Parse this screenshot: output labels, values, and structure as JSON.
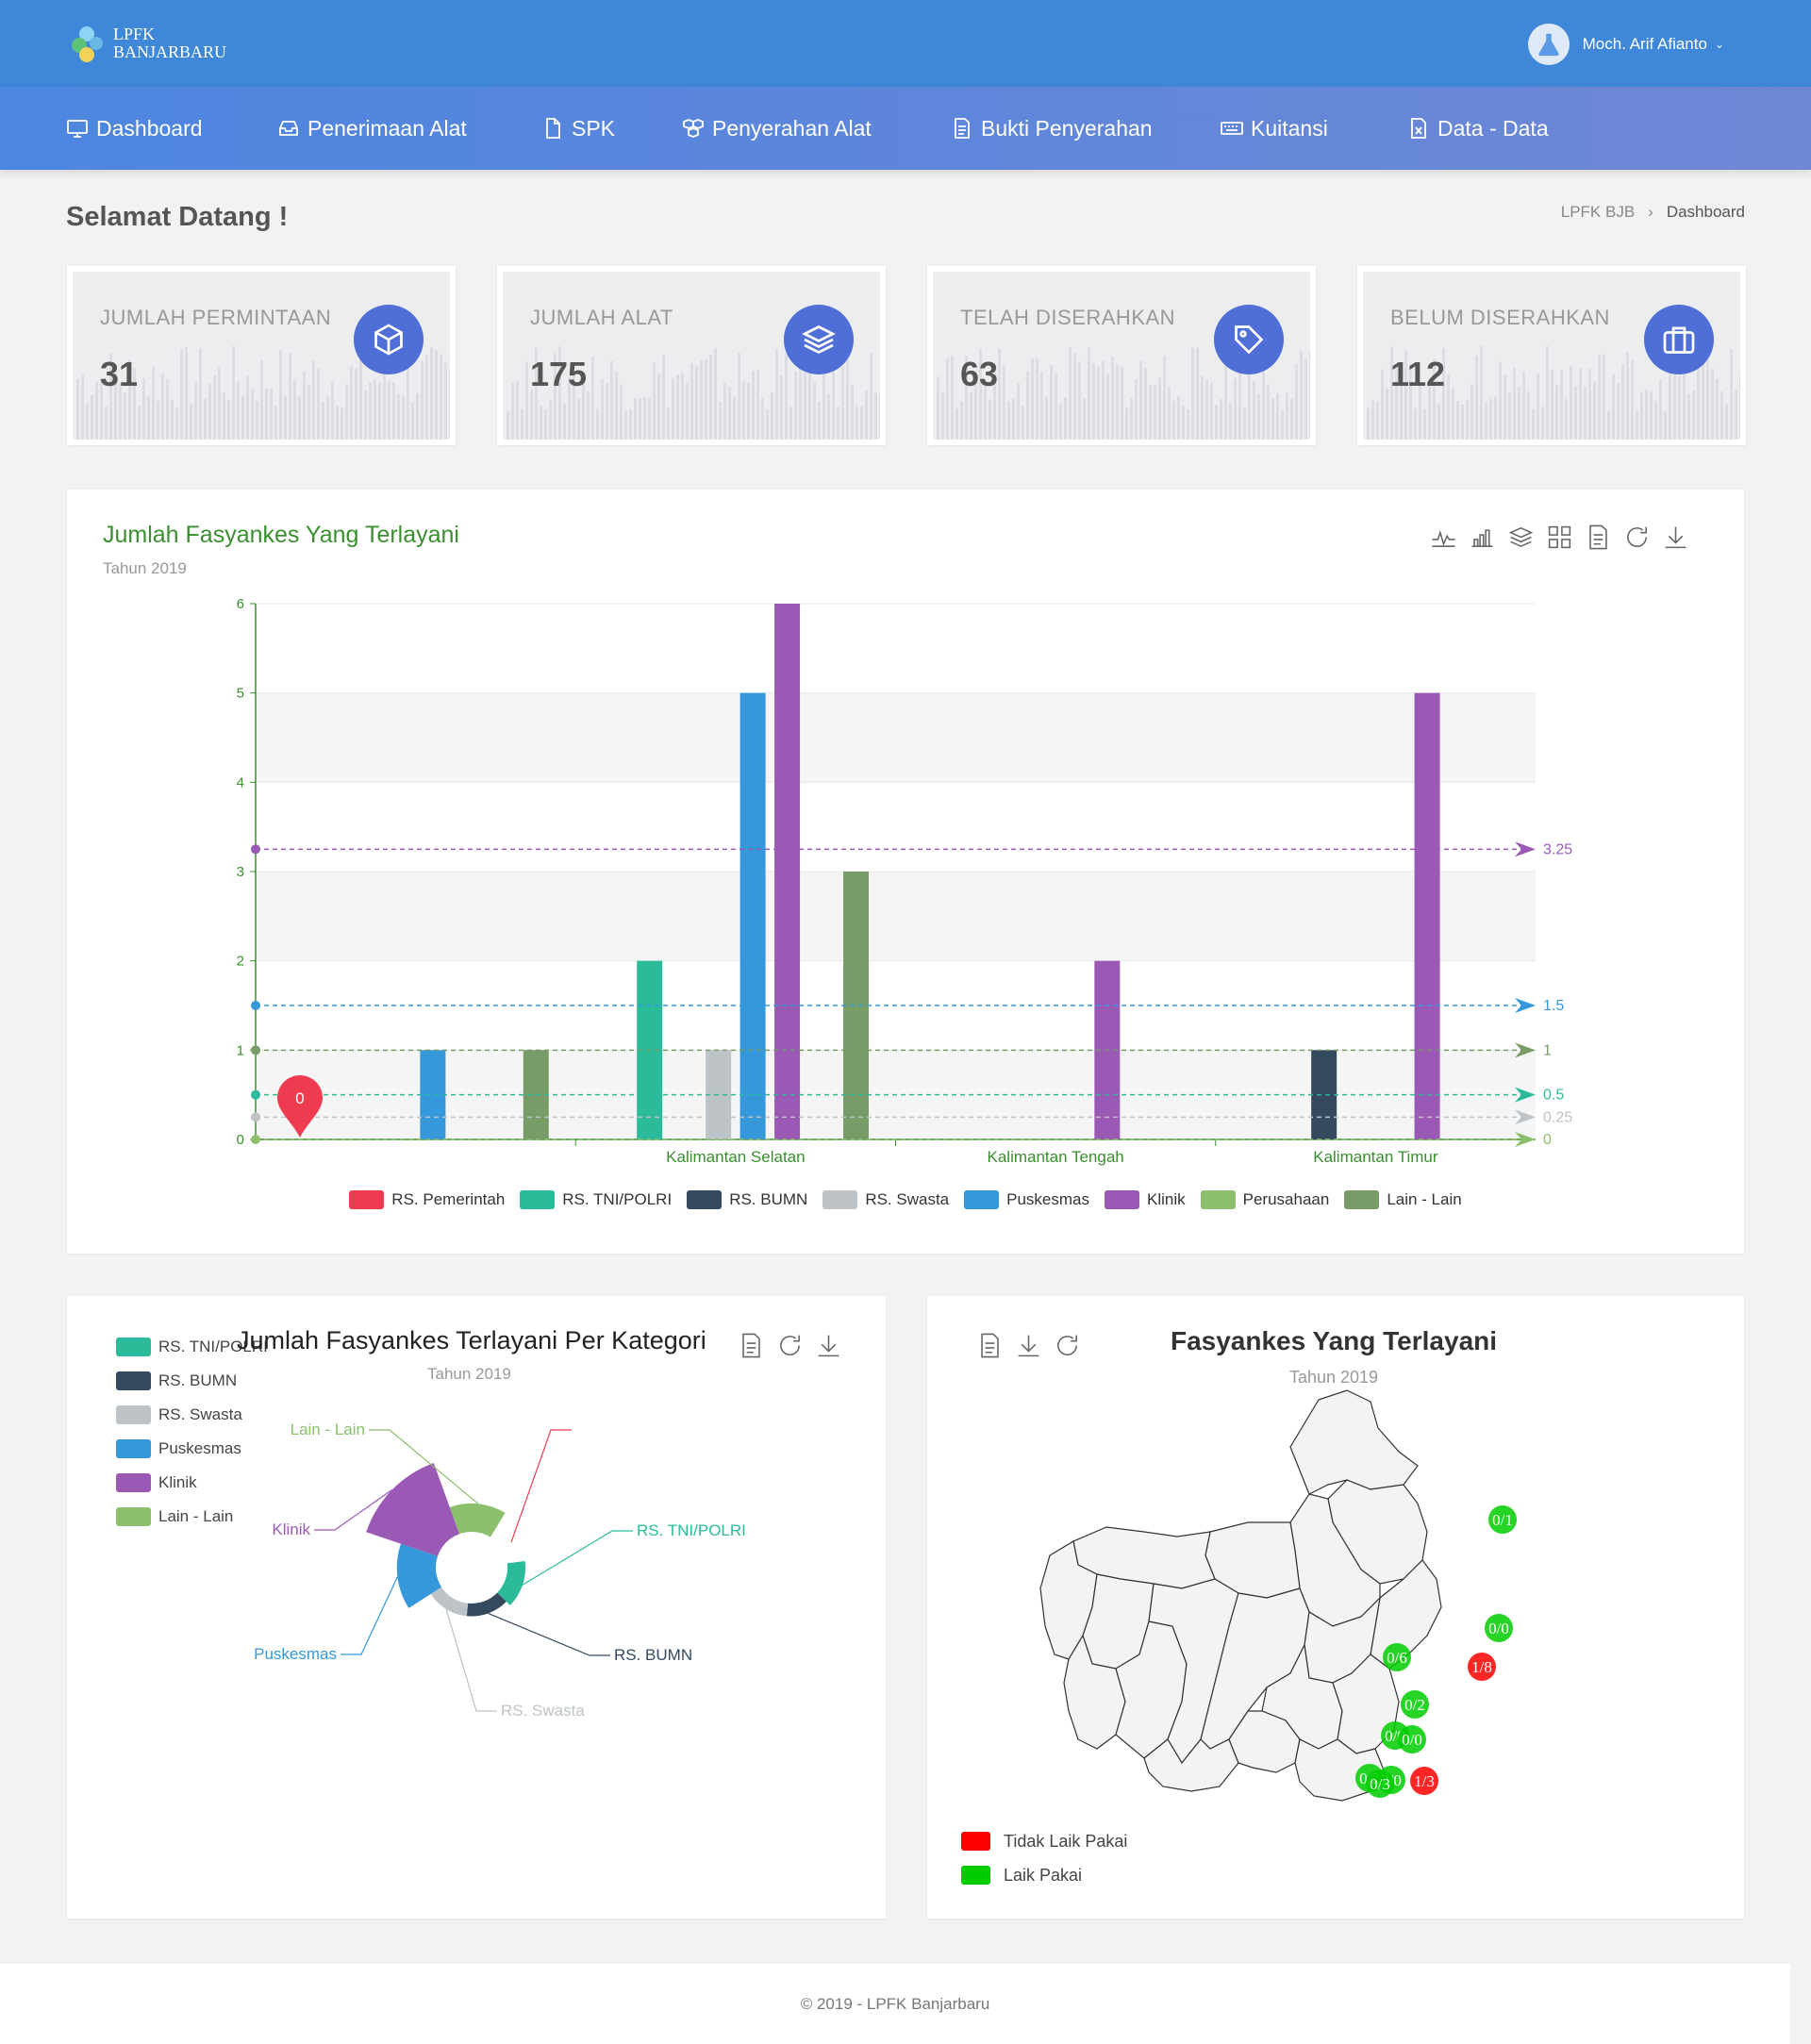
{
  "header": {
    "logo_line1": "LPFK",
    "logo_line2": "BANJARBARU",
    "user_name": "Moch. Arif Afianto"
  },
  "nav": [
    {
      "label": "Dashboard",
      "icon": "monitor-icon"
    },
    {
      "label": "Penerimaan Alat",
      "icon": "inbox-icon"
    },
    {
      "label": "SPK",
      "icon": "file-icon"
    },
    {
      "label": "Penyerahan Alat",
      "icon": "boxes-icon"
    },
    {
      "label": "Bukti Penyerahan",
      "icon": "document-icon"
    },
    {
      "label": "Kuitansi",
      "icon": "keyboard-icon"
    },
    {
      "label": "Data - Data",
      "icon": "excel-icon"
    }
  ],
  "page": {
    "welcome": "Selamat Datang !",
    "breadcrumb": [
      "LPFK BJB",
      "Dashboard"
    ]
  },
  "stats": [
    {
      "title": "JUMLAH PERMINTAAN",
      "value": "31",
      "icon": "cube-icon"
    },
    {
      "title": "JUMLAH ALAT",
      "value": "175",
      "icon": "layers-icon"
    },
    {
      "title": "TELAH DISERAHKAN",
      "value": "63",
      "icon": "tag-icon"
    },
    {
      "title": "BELUM DISERAHKAN",
      "value": "112",
      "icon": "briefcase-icon"
    }
  ],
  "colors": {
    "rs_pemerintah": "#ef3b4f",
    "rs_tni": "#2bbb9b",
    "rs_bumn": "#34495e",
    "rs_swasta": "#bdc3c7",
    "puskesmas": "#3498db",
    "klinik": "#9b59b6",
    "perusahaan": "#8cc06c",
    "lain": "#789c68",
    "tidak_laik": "#ff0000",
    "laik": "#00cc00"
  },
  "bar_panel": {
    "title": "Jumlah Fasyankes Yang Terlayani",
    "subtitle": "Tahun 2019"
  },
  "chart_data": [
    {
      "type": "bar",
      "title": "Jumlah Fasyankes Yang Terlayani",
      "subtitle": "Tahun 2019",
      "ylim": [
        0,
        6
      ],
      "yticks": [
        0,
        1,
        2,
        3,
        4,
        5,
        6
      ],
      "categories": [
        "",
        "Kalimantan Selatan",
        "Kalimantan Tengah",
        "Kalimantan Timur"
      ],
      "series": [
        {
          "name": "RS. Pemerintah",
          "values": [
            0,
            0,
            0,
            0
          ]
        },
        {
          "name": "RS. TNI/POLRI",
          "values": [
            0,
            2,
            0,
            0
          ]
        },
        {
          "name": "RS. BUMN",
          "values": [
            0,
            0,
            0,
            1
          ]
        },
        {
          "name": "RS. Swasta",
          "values": [
            0,
            1,
            0,
            0
          ]
        },
        {
          "name": "Puskesmas",
          "values": [
            1,
            5,
            0,
            0
          ]
        },
        {
          "name": "Klinik",
          "values": [
            0,
            6,
            2,
            5
          ]
        },
        {
          "name": "Perusahaan",
          "values": [
            0,
            0,
            0,
            0
          ]
        },
        {
          "name": "Lain - Lain",
          "values": [
            1,
            3,
            0,
            0
          ]
        }
      ],
      "mark_lines": [
        {
          "value": 3.25,
          "label": "3.25",
          "series": "Klinik"
        },
        {
          "value": 1.5,
          "label": "1.5",
          "series": "Puskesmas"
        },
        {
          "value": 1,
          "label": "1",
          "series": "Lain - Lain"
        },
        {
          "value": 0.5,
          "label": "0.5",
          "series": "RS. TNI/POLRI"
        },
        {
          "value": 0.25,
          "label": "0.25",
          "series": "RS. Swasta"
        },
        {
          "value": 0,
          "label": "0",
          "series": "Perusahaan"
        }
      ],
      "mark_point": {
        "value": "0",
        "series": "RS. Pemerintah"
      },
      "grid": "horizontal split bands",
      "legend": "bottom-center"
    },
    {
      "type": "pie",
      "title": "Jumlah Fasyankes Terlayani Per Kategori",
      "subtitle": "Tahun 2019",
      "rose": true,
      "slices": [
        {
          "name": "",
          "value": 0
        },
        {
          "name": "RS. TNI/POLRI",
          "value": 2
        },
        {
          "name": "RS. BUMN",
          "value": 1
        },
        {
          "name": "RS. Swasta",
          "value": 1
        },
        {
          "name": "Puskesmas",
          "value": 6
        },
        {
          "name": "Klinik",
          "value": 13
        },
        {
          "name": "Lain - Lain",
          "value": 4
        }
      ],
      "legend": [
        "RS. TNI/POLRI",
        "RS. BUMN",
        "RS. Swasta",
        "Puskesmas",
        "Klinik",
        "Lain - Lain"
      ],
      "legend_position": "top-left"
    }
  ],
  "map_panel": {
    "title": "Fasyankes Yang Terlayani",
    "subtitle": "Tahun 2019",
    "legend": [
      {
        "label": "Tidak Laik Pakai",
        "color": "#ff0000"
      },
      {
        "label": "Laik Pakai",
        "color": "#00cc00"
      }
    ],
    "markers": [
      {
        "label": "0/1",
        "status": "laik"
      },
      {
        "label": "0/0",
        "status": "laik"
      },
      {
        "label": "1/8",
        "status": "tidak_laik"
      },
      {
        "label": "0/6",
        "status": "laik"
      },
      {
        "label": "0/2",
        "status": "laik"
      },
      {
        "label": "0/0",
        "status": "laik"
      },
      {
        "label": "0/0",
        "status": "laik"
      },
      {
        "label": "0/2",
        "status": "laik"
      },
      {
        "label": "2/0",
        "status": "laik"
      },
      {
        "label": "0/3",
        "status": "laik"
      },
      {
        "label": "1/3",
        "status": "tidak_laik"
      }
    ]
  },
  "footer": {
    "text": "© 2019 - LPFK Banjarbaru"
  }
}
